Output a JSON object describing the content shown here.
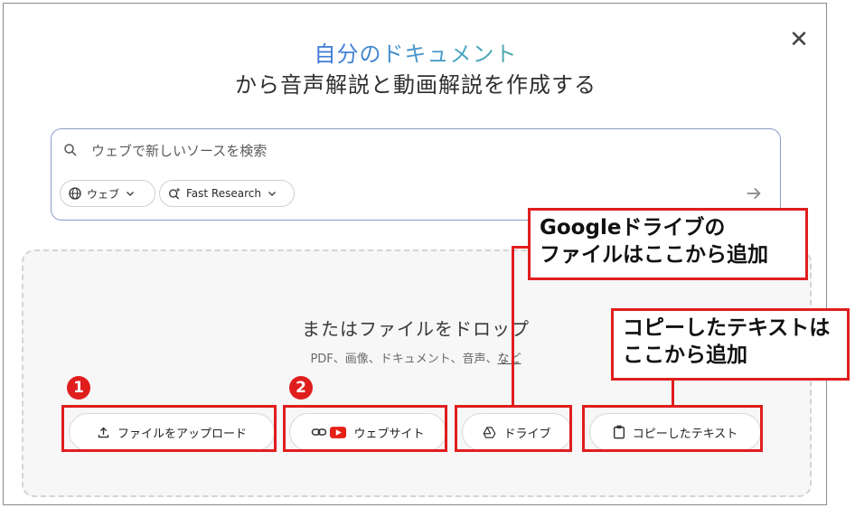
{
  "dialog": {
    "title_line1": "自分のドキュメント",
    "title_line2": "から音声解説と動画解説を作成する",
    "close_symbol": "✕"
  },
  "search": {
    "placeholder": "ウェブで新しいソースを検索",
    "source_chip": "ウェブ",
    "mode_chip": "Fast Research",
    "icons": [
      "search-icon",
      "globe-icon",
      "research-icon",
      "arrow-right-icon"
    ]
  },
  "dropzone": {
    "title": "またはファイルをドロップ",
    "subtitle": "PDF、画像、ドキュメント、音声、",
    "subtitle_link": "など"
  },
  "buttons": {
    "upload": "ファイルをアップロード",
    "website": "ウェブサイト",
    "drive": "ドライブ",
    "copied_text": "コピーしたテキスト"
  },
  "annotations": {
    "badge1": "1",
    "badge2": "2",
    "drive_callout_line1": "Googleドライブの",
    "drive_callout_line2": "ファイルはここから追加",
    "text_callout_line1": "コピーしたテキストは",
    "text_callout_line2": "ここから追加",
    "accent_color": "#e01e1e"
  }
}
